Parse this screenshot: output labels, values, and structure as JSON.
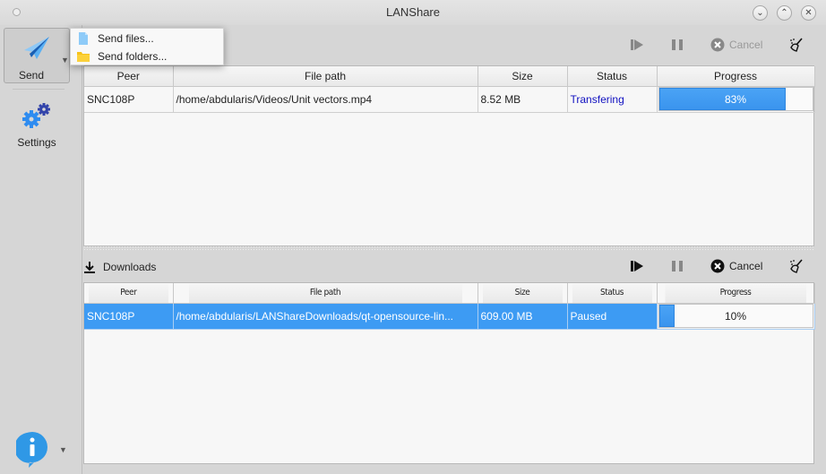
{
  "window": {
    "title": "LANShare",
    "buttons": [
      "minimize",
      "maximize",
      "close"
    ]
  },
  "sidebar": {
    "send": {
      "label": "Send",
      "icon": "paper-plane-icon"
    },
    "settings": {
      "label": "Settings",
      "icon": "gears-icon"
    },
    "info": {
      "icon": "info-icon"
    }
  },
  "send_menu": {
    "items": [
      {
        "label": "Send files...",
        "icon": "file-icon"
      },
      {
        "label": "Send folders...",
        "icon": "folder-icon"
      }
    ]
  },
  "uploads": {
    "toolbar": {
      "resume": "",
      "pause": "",
      "cancel": "Cancel",
      "clear": ""
    },
    "columns": [
      "Peer",
      "File path",
      "Size",
      "Status",
      "Progress"
    ],
    "rows": [
      {
        "peer": "SNC108P",
        "path": "/home/abdularis/Videos/Unit vectors.mp4",
        "size": "8.52 MB",
        "status": "Transfering",
        "progress": 83,
        "progress_text": "83%"
      }
    ]
  },
  "downloads": {
    "title": "Downloads",
    "toolbar": {
      "cancel": "Cancel"
    },
    "columns": [
      "Peer",
      "File path",
      "Size",
      "Status",
      "Progress"
    ],
    "rows": [
      {
        "peer": "SNC108P",
        "path": "/home/abdularis/LANShareDownloads/qt-opensource-lin...",
        "size": "609.00 MB",
        "status": "Paused",
        "progress": 10,
        "progress_text": "10%"
      }
    ]
  },
  "colors": {
    "accent": "#3d9bf3",
    "status_transfer": "#1010c0"
  }
}
